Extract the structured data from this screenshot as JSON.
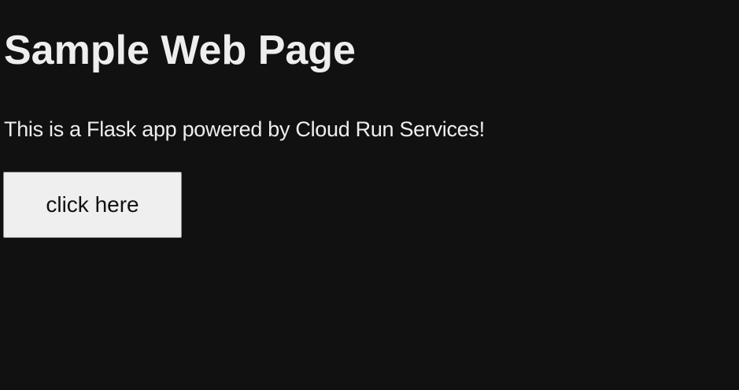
{
  "page": {
    "title": "Sample Web Page",
    "description": "This is a Flask app powered by Cloud Run Services!",
    "button_label": "click here"
  },
  "colors": {
    "background": "#111111",
    "text": "#eeeeee",
    "button_background": "#efefef",
    "button_text": "#111111"
  }
}
